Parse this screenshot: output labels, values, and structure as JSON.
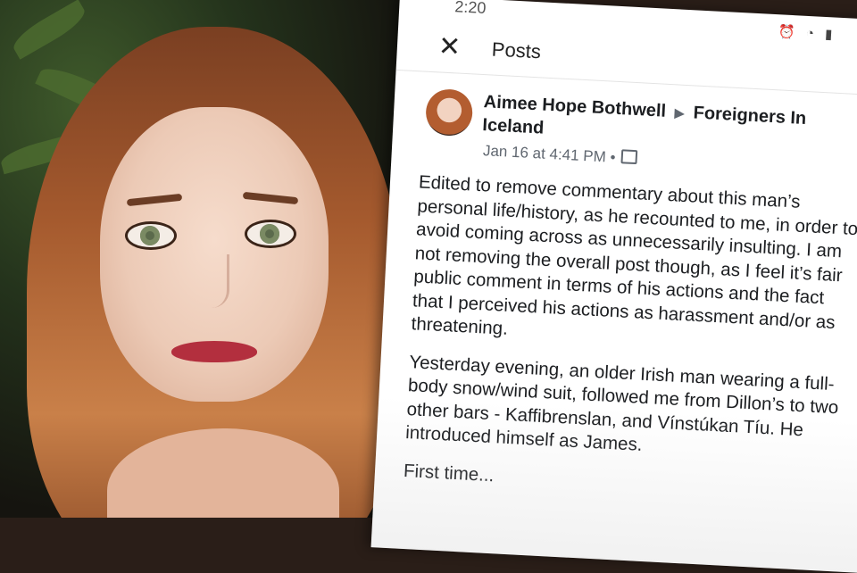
{
  "statusbar": {
    "time": "2:20",
    "icons": "⏰ ◔ ▮"
  },
  "topbar": {
    "close_icon": "close-icon",
    "title": "Posts"
  },
  "post": {
    "author": "Aimee Hope Bothwell",
    "separator": "▶",
    "group": "Foreigners In Iceland",
    "date": "Jan 16 at 4:41 PM",
    "date_dot": "•",
    "paragraphs": [
      "Edited to remove commentary about this man’s personal life/history, as he recounted to me, in order to avoid coming across as unnecessarily insulting. I am not removing the overall post though, as I feel it’s fair public comment in terms of his actions and the fact that I perceived his actions as harassment and/or as threatening.",
      "Yesterday evening, an older Irish man wearing a full-body snow/wind suit, followed me from Dillon’s to two other bars - Kaffibrenslan, and Vínstúkan Tíu. He introduced himself as James.",
      "First time..."
    ]
  },
  "colors": {
    "text": "#1c1e21",
    "secondary": "#606770",
    "background": "#ffffff"
  }
}
